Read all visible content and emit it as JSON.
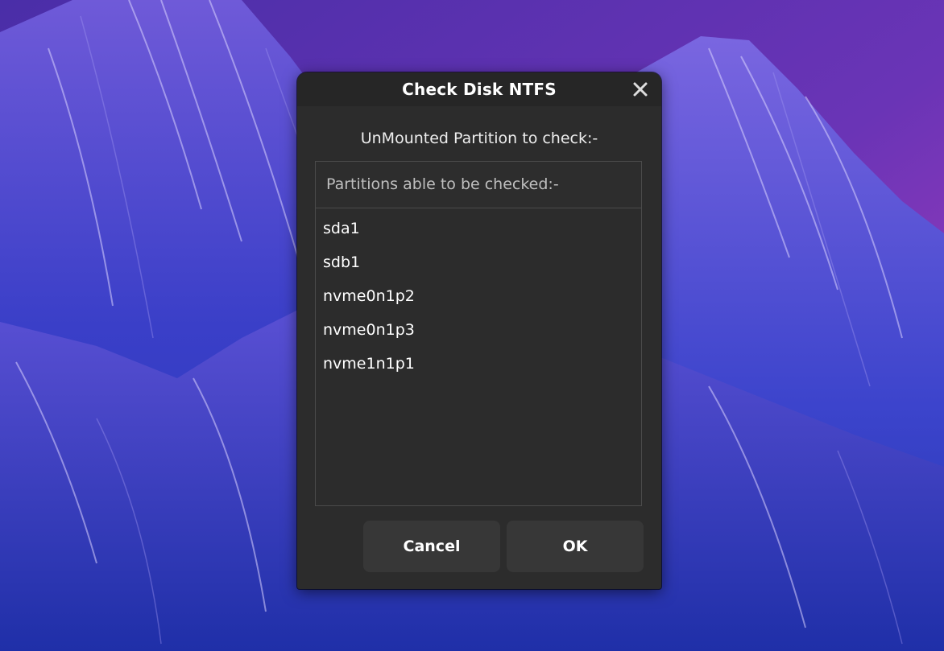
{
  "dialog": {
    "title": "Check Disk NTFS",
    "close_icon": "close-icon",
    "heading": "UnMounted Partition to check:-",
    "list": {
      "header": "Partitions able to be checked:-",
      "items": [
        "sda1",
        "sdb1",
        "nvme0n1p2",
        "nvme0n1p3",
        "nvme1n1p1"
      ]
    },
    "buttons": {
      "cancel": "Cancel",
      "ok": "OK"
    }
  },
  "colors": {
    "dialog_bg": "#2c2c2c",
    "titlebar_bg": "#262626",
    "button_bg": "#373737",
    "list_border": "#4b4b4b",
    "wallpaper_top": "#5a35b8",
    "wallpaper_bottom": "#2c3fcf"
  }
}
